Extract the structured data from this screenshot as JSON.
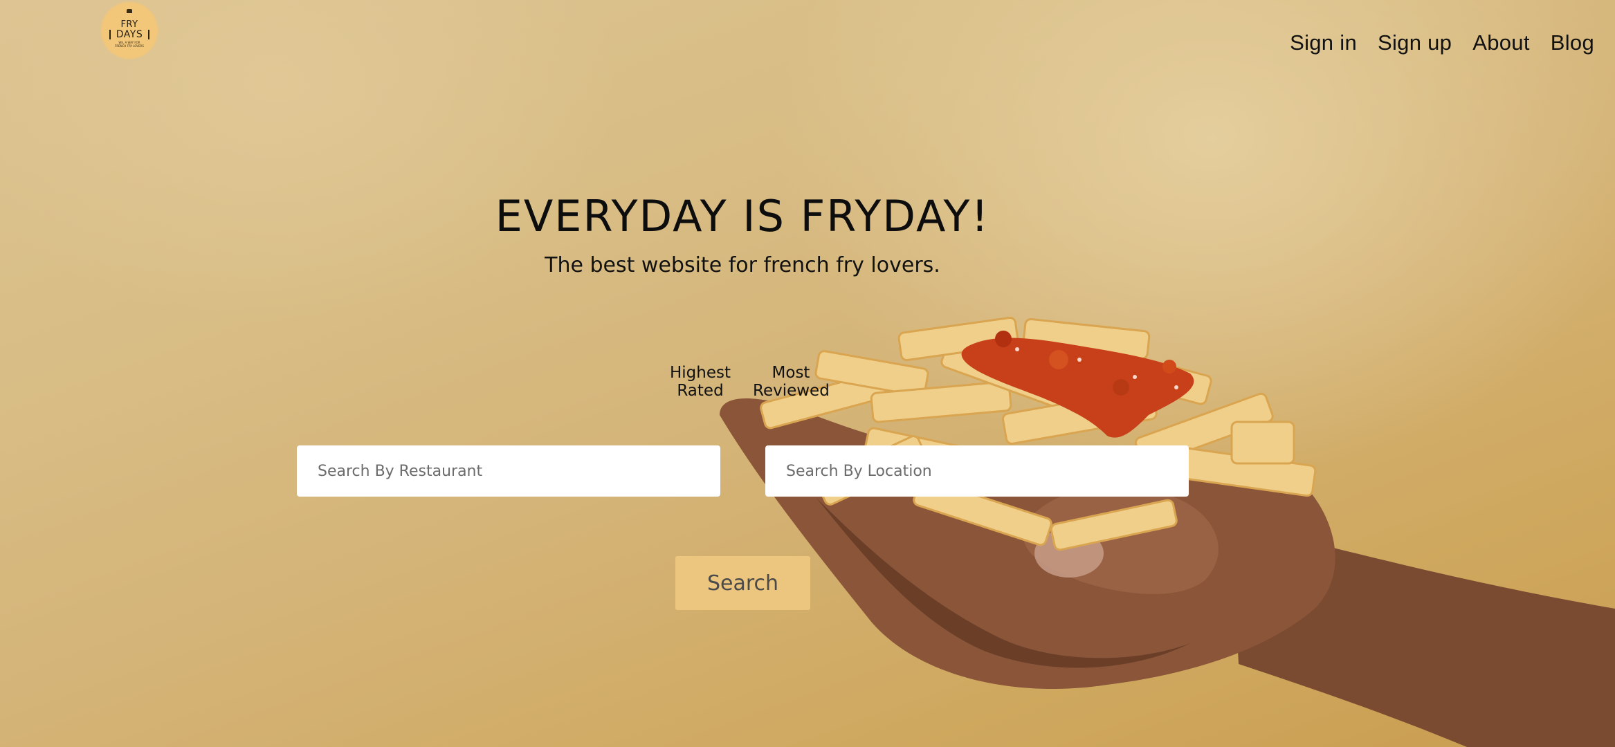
{
  "logo": {
    "line1": "FRY",
    "line2": "DAYS",
    "tagline": "WE, A WAY FOR FRENCH FRY LOVERS"
  },
  "nav": {
    "items": [
      {
        "label": "Sign in"
      },
      {
        "label": "Sign up"
      },
      {
        "label": "About"
      },
      {
        "label": "Blog"
      }
    ]
  },
  "hero": {
    "title": "EVERYDAY IS FRYDAY!",
    "subtitle": "The best website for french fry lovers."
  },
  "sort": {
    "highest_rated": "Highest\nRated",
    "most_reviewed": "Most\nReviewed"
  },
  "search": {
    "restaurant_placeholder": "Search By Restaurant",
    "location_placeholder": "Search By Location",
    "button_label": "Search"
  },
  "colors": {
    "background": "#d4b376",
    "logo_circle": "#f2c77a",
    "search_button": "#ecc67f",
    "input_background": "#ffffff"
  },
  "icons": {
    "hero_image": "hand-holding-fries-with-ketchup"
  }
}
